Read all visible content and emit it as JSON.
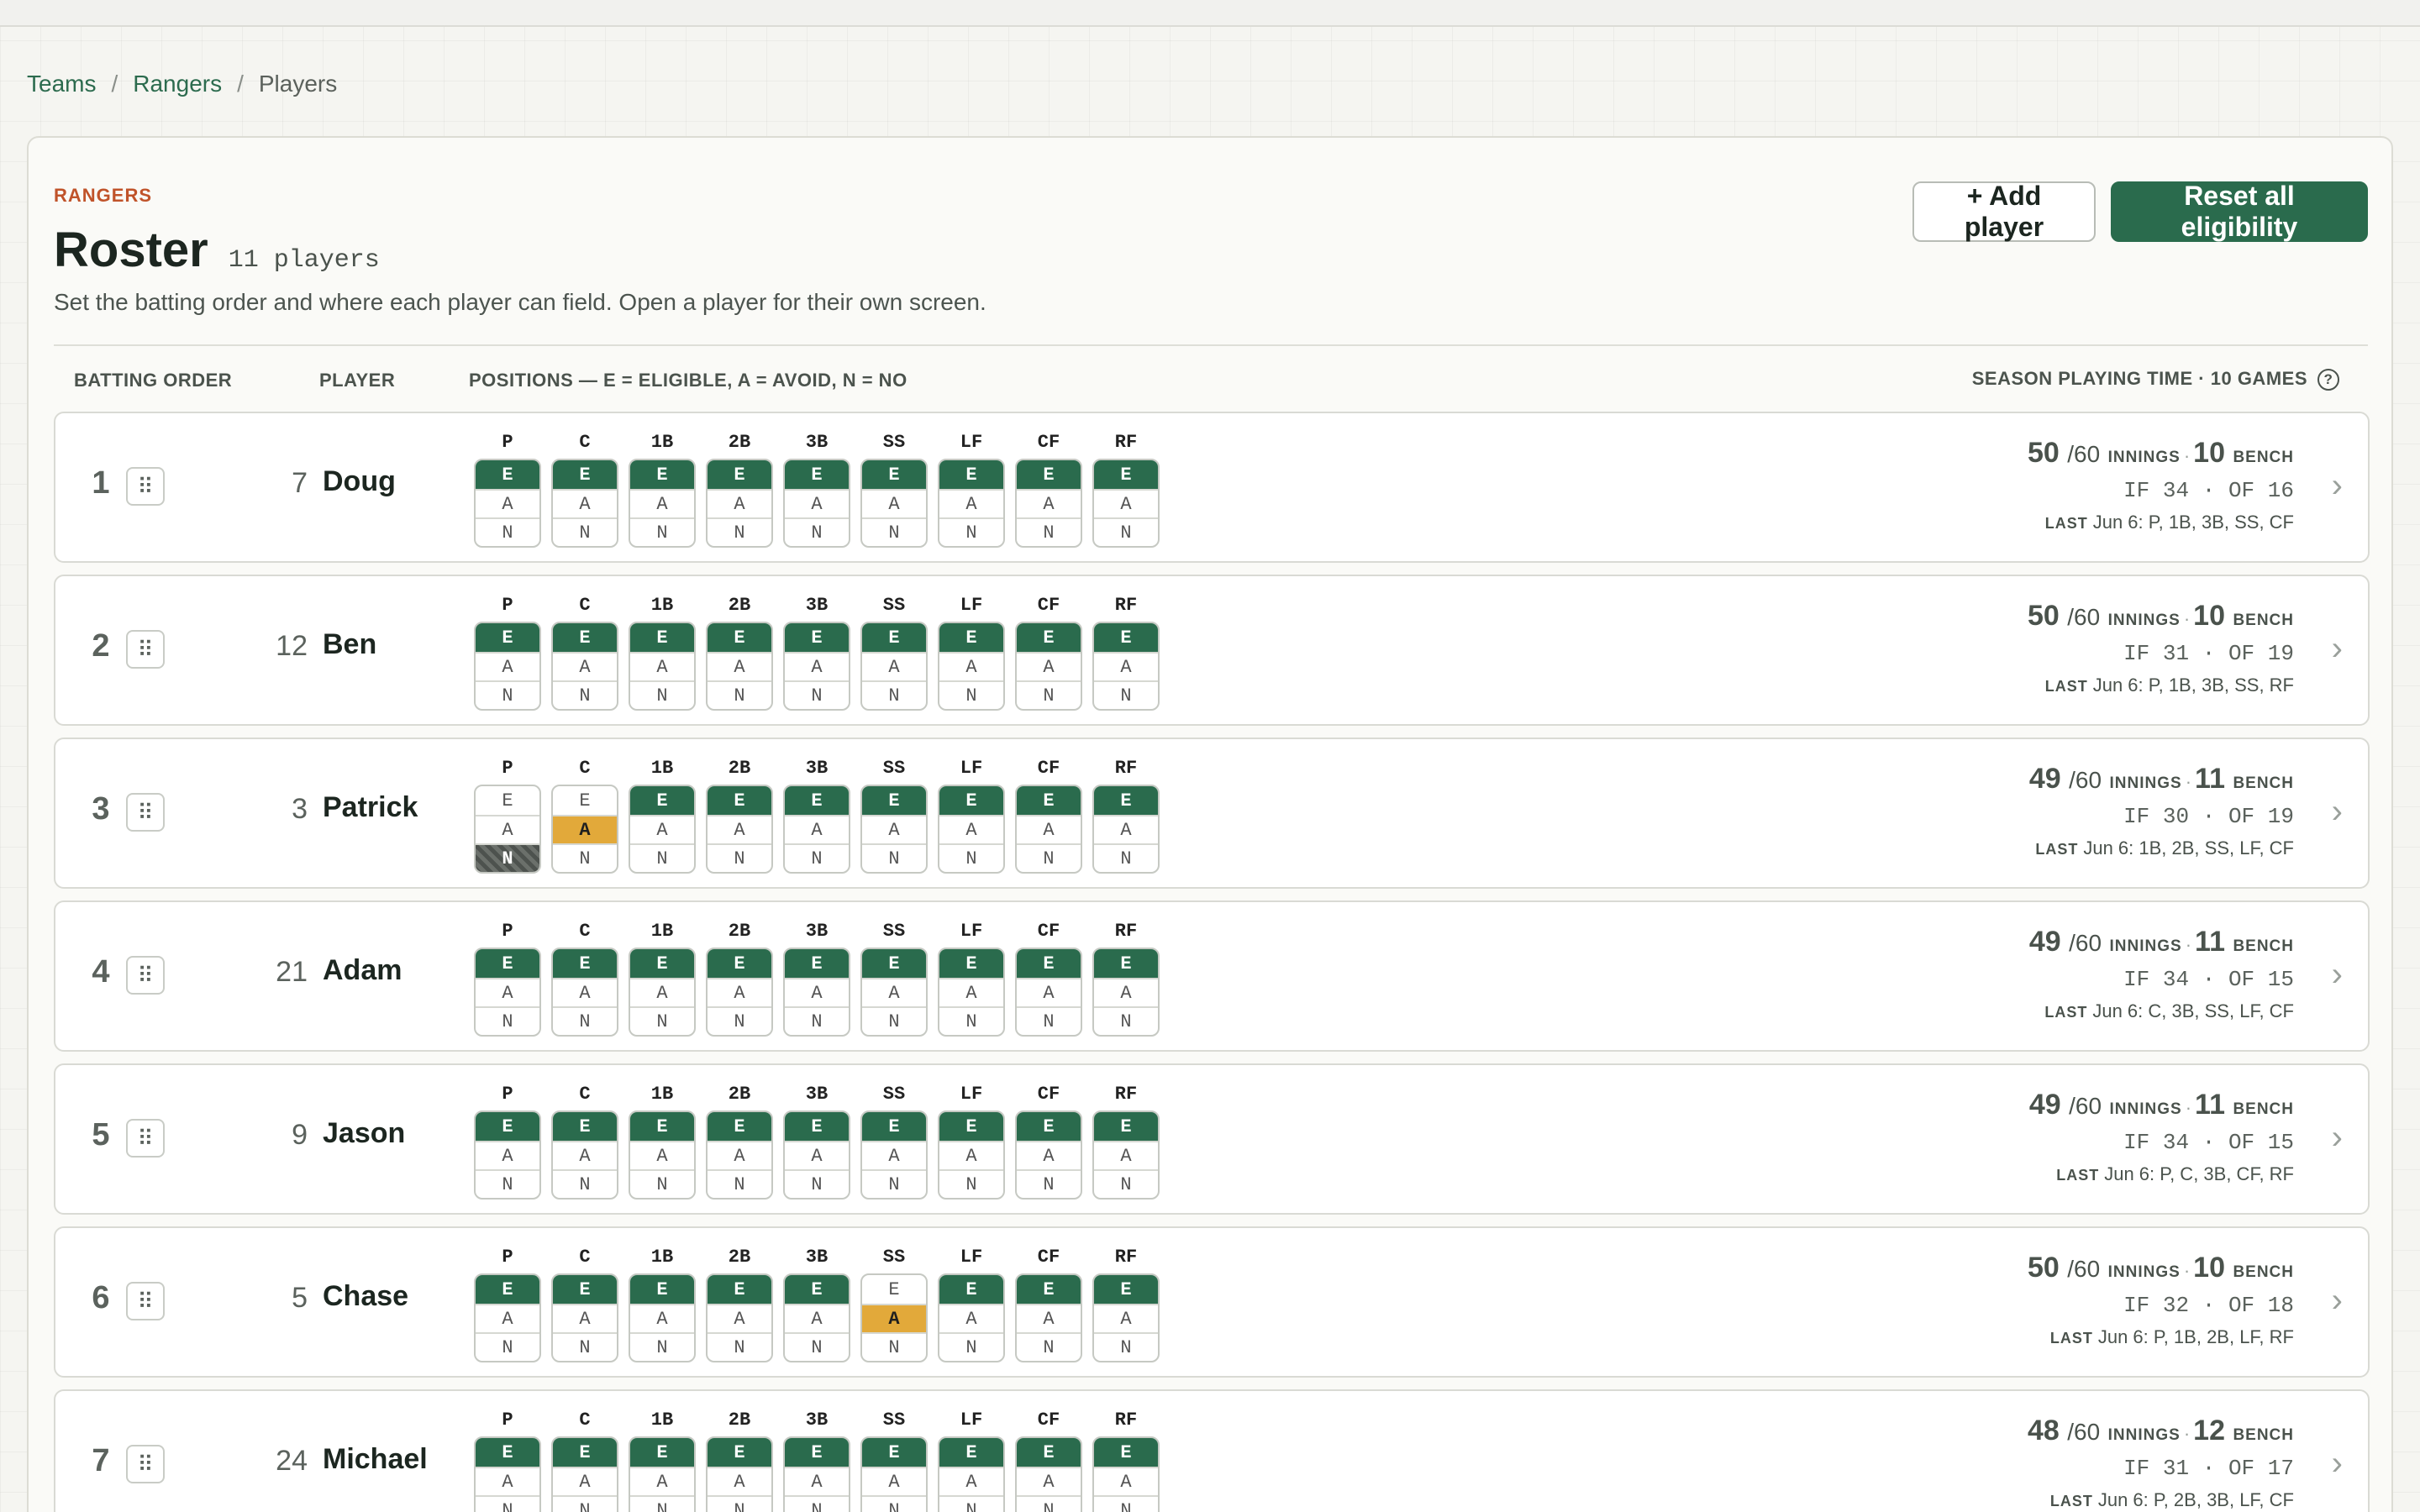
{
  "breadcrumb": {
    "teams": "Teams",
    "team": "Rangers",
    "current": "Players",
    "sep": "/"
  },
  "header": {
    "team_label": "RANGERS",
    "title": "Roster",
    "count": "11 players",
    "subtitle": "Set the batting order and where each player can field. Open a player for their own screen.",
    "add_player": "+ Add player",
    "reset": "Reset all eligibility"
  },
  "columns": {
    "batting_order": "BATTING ORDER",
    "player": "PLAYER",
    "positions": "POSITIONS — E = ELIGIBLE, A = AVOID, N = NO",
    "season": "SEASON PLAYING TIME · 10 GAMES",
    "help": "?"
  },
  "positions": [
    "P",
    "C",
    "1B",
    "2B",
    "3B",
    "SS",
    "LF",
    "CF",
    "RF"
  ],
  "options": [
    "E",
    "A",
    "N"
  ],
  "labels": {
    "innings": "INNINGS",
    "bench": "BENCH",
    "last": "LAST",
    "if": "IF",
    "of": "OF",
    "of_innings": "/60",
    "dot": "·"
  },
  "players": [
    {
      "order": "1",
      "jersey": "7",
      "name": "Doug",
      "elig": [
        "E",
        "E",
        "E",
        "E",
        "E",
        "E",
        "E",
        "E",
        "E"
      ],
      "innings": "50",
      "bench": "10",
      "if": "34",
      "of": "16",
      "last": "Jun 6: P, 1B, 3B, SS, CF"
    },
    {
      "order": "2",
      "jersey": "12",
      "name": "Ben",
      "elig": [
        "E",
        "E",
        "E",
        "E",
        "E",
        "E",
        "E",
        "E",
        "E"
      ],
      "innings": "50",
      "bench": "10",
      "if": "31",
      "of": "19",
      "last": "Jun 6: P, 1B, 3B, SS, RF"
    },
    {
      "order": "3",
      "jersey": "3",
      "name": "Patrick",
      "elig": [
        "N",
        "A",
        "E",
        "E",
        "E",
        "E",
        "E",
        "E",
        "E"
      ],
      "innings": "49",
      "bench": "11",
      "if": "30",
      "of": "19",
      "last": "Jun 6: 1B, 2B, SS, LF, CF"
    },
    {
      "order": "4",
      "jersey": "21",
      "name": "Adam",
      "elig": [
        "E",
        "E",
        "E",
        "E",
        "E",
        "E",
        "E",
        "E",
        "E"
      ],
      "innings": "49",
      "bench": "11",
      "if": "34",
      "of": "15",
      "last": "Jun 6: C, 3B, SS, LF, CF"
    },
    {
      "order": "5",
      "jersey": "9",
      "name": "Jason",
      "elig": [
        "E",
        "E",
        "E",
        "E",
        "E",
        "E",
        "E",
        "E",
        "E"
      ],
      "innings": "49",
      "bench": "11",
      "if": "34",
      "of": "15",
      "last": "Jun 6: P, C, 3B, CF, RF"
    },
    {
      "order": "6",
      "jersey": "5",
      "name": "Chase",
      "elig": [
        "E",
        "E",
        "E",
        "E",
        "E",
        "A",
        "E",
        "E",
        "E"
      ],
      "innings": "50",
      "bench": "10",
      "if": "32",
      "of": "18",
      "last": "Jun 6: P, 1B, 2B, LF, RF"
    },
    {
      "order": "7",
      "jersey": "24",
      "name": "Michael",
      "elig": [
        "E",
        "E",
        "E",
        "E",
        "E",
        "E",
        "E",
        "E",
        "E"
      ],
      "innings": "48",
      "bench": "12",
      "if": "31",
      "of": "17",
      "last": "Jun 6: P, 2B, 3B, LF, CF"
    }
  ],
  "colors": {
    "eligible": "#2a6b4d",
    "avoid": "#e2a93a",
    "no": "#4d524e",
    "accent": "#c0532a"
  }
}
